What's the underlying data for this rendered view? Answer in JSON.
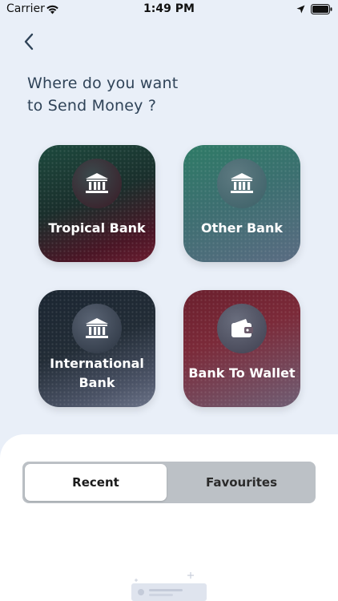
{
  "status_bar": {
    "carrier": "Carrier",
    "time": "1:49 PM"
  },
  "header": {
    "title_line1": "Where do you want",
    "title_line2": "to Send Money ?"
  },
  "tiles": [
    {
      "label": "Tropical Bank",
      "icon": "bank-icon"
    },
    {
      "label": "Other Bank",
      "icon": "bank-icon"
    },
    {
      "label_line1": "International",
      "label_line2": "Bank",
      "icon": "bank-icon"
    },
    {
      "label": "Bank To Wallet",
      "icon": "wallet-icon"
    }
  ],
  "tabs": {
    "recent": "Recent",
    "favourites": "Favourites",
    "selected": "Recent"
  },
  "colors": {
    "background": "#e9eff8",
    "title": "#2f4358",
    "tab_track": "#bcc1c6"
  }
}
